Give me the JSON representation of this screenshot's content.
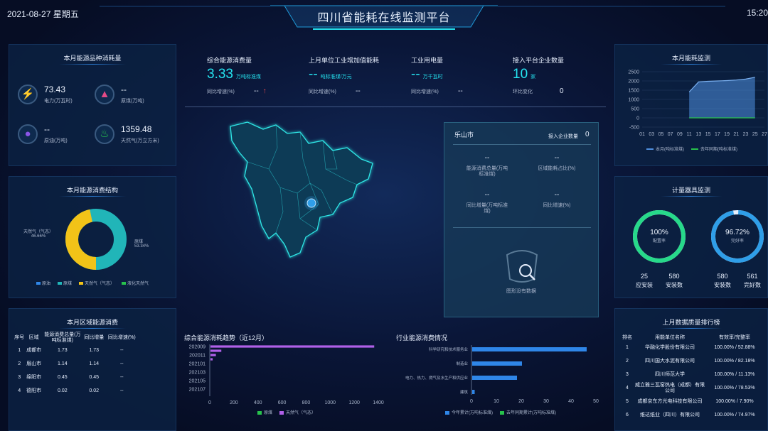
{
  "header": {
    "date": "2021-08-27 星期五",
    "title": "四川省能耗在线监测平台",
    "time": "15:20"
  },
  "energy_types": {
    "title": "本月能源品种消耗量",
    "items": [
      {
        "value": "73.43",
        "label": "电力(万瓦时)",
        "icon": "lightning-icon",
        "color": "#f2c318"
      },
      {
        "value": "--",
        "label": "原煤(万吨)",
        "icon": "coal-icon",
        "color": "#e24a86"
      },
      {
        "value": "--",
        "label": "原油(万吨)",
        "icon": "oil-drop-icon",
        "color": "#8a55e6"
      },
      {
        "value": "1359.48",
        "label": "天然气(万立方米)",
        "icon": "flame-icon",
        "color": "#27c24c"
      }
    ]
  },
  "structure": {
    "title": "本月能源消费结构",
    "label_left": "天然气（气态）",
    "pct_left": "46.66%",
    "label_right": "原煤",
    "pct_right": "53.34%",
    "legend": [
      {
        "name": "原油",
        "color": "#2f86e8"
      },
      {
        "name": "原煤",
        "color": "#21b5b8"
      },
      {
        "name": "天然气（气态）",
        "color": "#f2c318"
      },
      {
        "name": "液化天然气",
        "color": "#27c24c"
      }
    ]
  },
  "region_table": {
    "title": "本月区域能源消费",
    "headers": [
      "序号",
      "区域",
      "能源消费总量(万吨标准煤)",
      "同比增量",
      "同比增速(%)"
    ],
    "rows": [
      [
        "1",
        "成都市",
        "1.73",
        "1.73",
        "--"
      ],
      [
        "2",
        "眉山市",
        "1.14",
        "1.14",
        "--"
      ],
      [
        "3",
        "绵阳市",
        "0.45",
        "0.45",
        "--"
      ],
      [
        "4",
        "德阳市",
        "0.02",
        "0.02",
        "--"
      ]
    ]
  },
  "kpis": [
    {
      "label": "综合能源消费量",
      "value": "3.33",
      "unit": "万吨标准煤",
      "sub_label": "同比增速(%)",
      "sub_value": "--",
      "arrow": "↑"
    },
    {
      "label": "上月单位工业增加值能耗",
      "value": "--",
      "unit": "吨标准煤/万元",
      "sub_label": "同比增速(%)",
      "sub_value": "--",
      "arrow": ""
    },
    {
      "label": "工业用电量",
      "value": "--",
      "unit": "万千瓦时",
      "sub_label": "同比增速(%)",
      "sub_value": "--",
      "arrow": ""
    },
    {
      "label": "接入平台企业数量",
      "value": "10",
      "unit": "家",
      "sub_label": "环比变化",
      "sub_value": "0",
      "arrow": ""
    }
  ],
  "city_card": {
    "name": "乐山市",
    "count_label": "接入企业数量",
    "count": "0",
    "metrics": [
      {
        "value": "--",
        "label": "能源消费总量(万吨标准煤)"
      },
      {
        "value": "--",
        "label": "区域能耗占比(%)"
      },
      {
        "value": "--",
        "label": "同比增量(万吨标准煤)"
      },
      {
        "value": "--",
        "label": "同比增速(%)"
      }
    ],
    "empty_text": "图形没有数据"
  },
  "monitor_chart": {
    "title": "本月能耗监测",
    "legend": [
      {
        "name": "本月(吨标准煤)",
        "color": "#4f8fe0"
      },
      {
        "name": "去年同期(吨标准煤)",
        "color": "#27c24c"
      }
    ],
    "chart_data": {
      "type": "area",
      "x": [
        "01",
        "03",
        "05",
        "07",
        "09",
        "11",
        "13",
        "15",
        "17",
        "19",
        "21",
        "23",
        "25",
        "27"
      ],
      "y_ticks": [
        "2500",
        "2000",
        "1500",
        "1000",
        "500",
        "0",
        "-500"
      ],
      "ylim": [
        -500,
        2500
      ],
      "series": [
        {
          "name": "本月(吨标准煤)",
          "values": [
            null,
            null,
            null,
            null,
            null,
            1400,
            1950,
            1980,
            2000,
            2020,
            2050,
            2100,
            2200,
            null
          ]
        },
        {
          "name": "去年同期(吨标准煤)",
          "values": [
            null,
            null,
            null,
            null,
            null,
            0,
            0,
            0,
            0,
            0,
            0,
            0,
            0,
            null
          ]
        }
      ]
    }
  },
  "meter_monitor": {
    "title": "计量器具监测",
    "rings": [
      {
        "value": "100%",
        "label": "配置率",
        "pct": 100,
        "color": "#27d98a",
        "stats": [
          {
            "value": "25",
            "label": "应安装"
          },
          {
            "value": "580",
            "label": "安装数"
          }
        ]
      },
      {
        "value": "96.72%",
        "label": "完好率",
        "pct": 96.72,
        "color": "#2f9ee8",
        "stats": [
          {
            "value": "580",
            "label": "安装数"
          },
          {
            "value": "561",
            "label": "完好数"
          }
        ]
      }
    ]
  },
  "quality_rank": {
    "title": "上月数据质量排行榜",
    "headers": [
      "排名",
      "用能单位名称",
      "有效率/完整率"
    ],
    "rows": [
      [
        "1",
        "华融化学股份有限公司",
        "100.00% / 52.88%"
      ],
      [
        "2",
        "四川国大水泥有限公司",
        "100.00% / 82.18%"
      ],
      [
        "3",
        "四川师范大学",
        "100.00% / 11.13%"
      ],
      [
        "4",
        "威立雅三瓦窑热电（成都）有限公司",
        "100.00% / 78.53%"
      ],
      [
        "5",
        "成都京东方光电科技有限公司",
        "100.00% / 7.90%"
      ],
      [
        "6",
        "维达纸业（四川）有限公司",
        "100.00% / 74.97%"
      ]
    ]
  },
  "trend_chart": {
    "title": "综合能源消耗趋势（近12月）",
    "legend": [
      {
        "name": "原煤",
        "color": "#27c24c"
      },
      {
        "name": "天然气（气态）",
        "color": "#b060e8"
      }
    ],
    "chart_data": {
      "type": "bar",
      "categories": [
        "202009",
        "202011",
        "202101",
        "202103",
        "202105",
        "202107"
      ],
      "values": [
        1360,
        90,
        30,
        0,
        0,
        0
      ],
      "x_ticks": [
        "0",
        "200",
        "400",
        "600",
        "800",
        "1000",
        "1200",
        "1400"
      ],
      "xlim": [
        0,
        1400
      ]
    }
  },
  "industry_chart": {
    "title": "行业能源消费情况",
    "legend": [
      {
        "name": "今年累计(万吨标准煤)",
        "color": "#2f86e8"
      },
      {
        "name": "去年同期累计(万吨标准煤)",
        "color": "#27c24c"
      }
    ],
    "chart_data": {
      "type": "bar",
      "categories": [
        "科学研究和技术服务业",
        "制造业",
        "电力、热力、燃气及水生产和供应业",
        "建筑"
      ],
      "values": [
        46,
        20,
        18,
        1
      ],
      "x_ticks": [
        "0",
        "10",
        "20",
        "30",
        "40",
        "50"
      ],
      "xlim": [
        0,
        50
      ]
    }
  }
}
